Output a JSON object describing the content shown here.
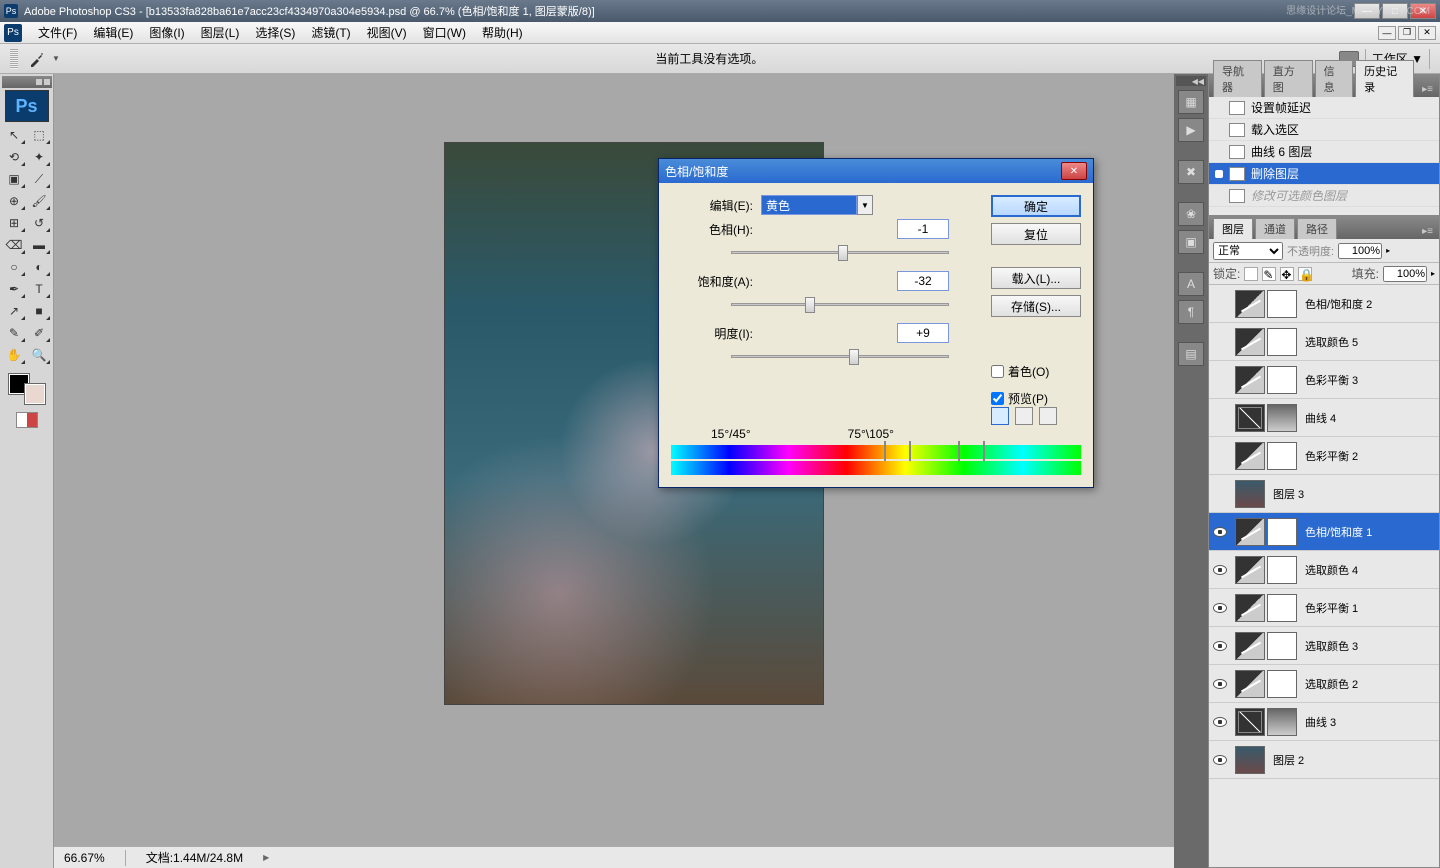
{
  "app": {
    "title": "Adobe Photoshop CS3 - [b13533fa828ba61e7acc23cf4334970a304e5934.psd @ 66.7% (色相/饱和度 1, 图层蒙版/8)]",
    "watermark": "思缘设计论坛_MISSYUAN.COM"
  },
  "menu": [
    "文件(F)",
    "编辑(E)",
    "图像(I)",
    "图层(L)",
    "选择(S)",
    "滤镜(T)",
    "视图(V)",
    "窗口(W)",
    "帮助(H)"
  ],
  "options_bar": {
    "message": "当前工具没有选项。",
    "workspace": "工作区 ▼"
  },
  "status": {
    "zoom": "66.67%",
    "doc": "文档:1.44M/24.8M"
  },
  "history": {
    "tabs": [
      "导航器",
      "直方图",
      "信息",
      "历史记录"
    ],
    "items": [
      {
        "label": "设置帧延迟"
      },
      {
        "label": "载入选区"
      },
      {
        "label": "曲线 6 图层"
      },
      {
        "label": "删除图层",
        "selected": true
      },
      {
        "label": "修改可选颜色图层",
        "dim": true
      }
    ]
  },
  "layers": {
    "tabs": [
      "图层",
      "通道",
      "路径"
    ],
    "blend": "正常",
    "opacity_label": "不透明度:",
    "opacity": "100%",
    "lock_label": "锁定:",
    "fill_label": "填充:",
    "fill": "100%",
    "items": [
      {
        "name": "色相/饱和度 2",
        "vis": false,
        "thumbs": [
          "adj",
          "mask"
        ]
      },
      {
        "name": "选取颜色 5",
        "vis": false,
        "thumbs": [
          "adj",
          "mask"
        ]
      },
      {
        "name": "色彩平衡 3",
        "vis": false,
        "thumbs": [
          "adj",
          "mask"
        ]
      },
      {
        "name": "曲线 4",
        "vis": false,
        "thumbs": [
          "curves",
          "maskg"
        ]
      },
      {
        "name": "色彩平衡 2",
        "vis": false,
        "thumbs": [
          "adj",
          "mask"
        ]
      },
      {
        "name": "图层 3",
        "vis": false,
        "thumbs": [
          "img"
        ]
      },
      {
        "name": "色相/饱和度 1",
        "vis": true,
        "thumbs": [
          "adj",
          "mask"
        ],
        "selected": true
      },
      {
        "name": "选取颜色 4",
        "vis": true,
        "thumbs": [
          "adj",
          "mask"
        ]
      },
      {
        "name": "色彩平衡 1",
        "vis": true,
        "thumbs": [
          "adj",
          "mask"
        ]
      },
      {
        "name": "选取颜色 3",
        "vis": true,
        "thumbs": [
          "adj",
          "mask"
        ]
      },
      {
        "name": "选取颜色 2",
        "vis": true,
        "thumbs": [
          "adj",
          "mask"
        ]
      },
      {
        "name": "曲线 3",
        "vis": true,
        "thumbs": [
          "curves",
          "maskg"
        ]
      },
      {
        "name": "图层 2",
        "vis": true,
        "thumbs": [
          "img"
        ]
      }
    ]
  },
  "dialog": {
    "title": "色相/饱和度",
    "edit_label": "编辑(E):",
    "edit_value": "黄色",
    "rows": [
      {
        "label": "色相(H):",
        "value": "-1",
        "thumb": 49
      },
      {
        "label": "饱和度(A):",
        "value": "-32",
        "thumb": 34
      },
      {
        "label": "明度(I):",
        "value": "+9",
        "thumb": 54
      }
    ],
    "range_left": "15°/45°",
    "range_right": "75°\\105°",
    "ok": "确定",
    "reset": "复位",
    "load": "载入(L)...",
    "save": "存储(S)...",
    "colorize": "着色(O)",
    "preview": "预览(P)"
  }
}
